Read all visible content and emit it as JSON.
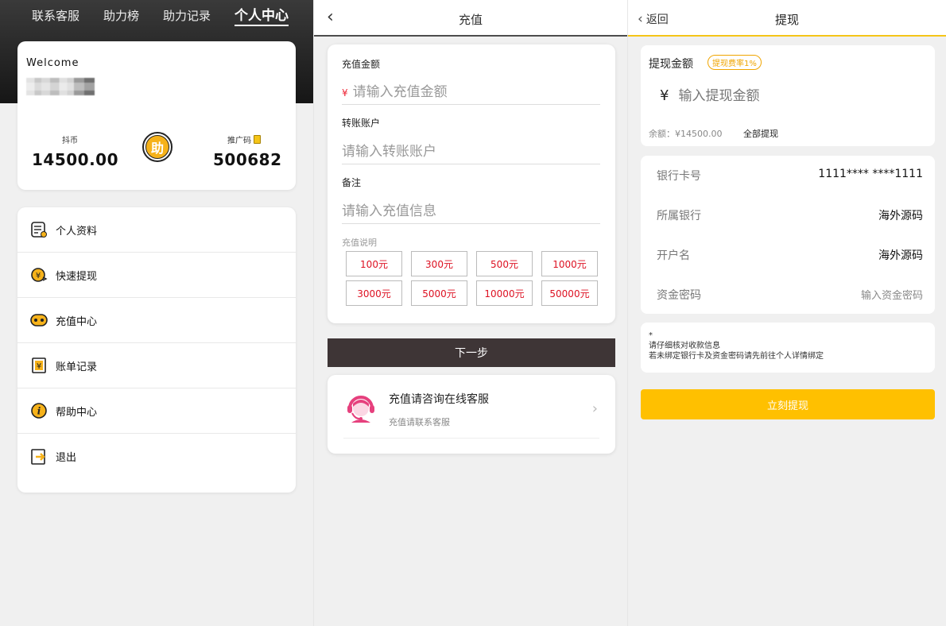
{
  "profile_panel": {
    "nav": [
      "联系客服",
      "助力榜",
      "助力记录",
      "个人中心"
    ],
    "welcome": "Welcome",
    "coins_label": "抖币",
    "coins_value": "14500.00",
    "badge_glyph": "助",
    "promo_label": "推广码",
    "promo_value": "500682",
    "menu": [
      {
        "label": "个人资料",
        "icon": "profile-icon"
      },
      {
        "label": "快速提现",
        "icon": "withdraw-icon"
      },
      {
        "label": "充值中心",
        "icon": "recharge-icon"
      },
      {
        "label": "账单记录",
        "icon": "bill-icon"
      },
      {
        "label": "帮助中心",
        "icon": "help-icon"
      },
      {
        "label": "退出",
        "icon": "logout-icon"
      }
    ],
    "colors": {
      "accent": "#f6b21a",
      "header_dark": "#1c1c1c"
    }
  },
  "recharge_panel": {
    "title": "充值",
    "amount_label": "充值金额",
    "amount_symbol": "¥",
    "amount_placeholder": "请输入充值金额",
    "account_label": "转账账户",
    "account_placeholder": "请输入转账账户",
    "note_label": "备注",
    "note_placeholder": "请输入充值信息",
    "amounts_label": "充值说明",
    "amounts": [
      "100元",
      "300元",
      "500元",
      "1000元",
      "3000元",
      "5000元",
      "10000元",
      "50000元"
    ],
    "next_label": "下一步",
    "service_title": "充值请咨询在线客服",
    "service_sub": "充值请联系客服",
    "colors": {
      "next_button": "#3e3536",
      "amount_text": "#d12222"
    }
  },
  "withdraw_panel": {
    "back_label": "返回",
    "title": "提现",
    "amount_label": "提现金额",
    "fee_badge": "提现费率1%",
    "amount_symbol": "¥",
    "amount_placeholder": "输入提现金额",
    "balance": "余额：¥14500.00",
    "withdraw_all": "全部提现",
    "fields": [
      {
        "key": "银行卡号",
        "value": "1111**** ****1111"
      },
      {
        "key": "所属银行",
        "value": "海外源码"
      },
      {
        "key": "开户名",
        "value": "海外源码"
      },
      {
        "key": "资金密码",
        "value": "输入资金密码"
      }
    ],
    "notice_star": "*",
    "notice_1": "请仔细核对收款信息",
    "notice_2": "若未绑定银行卡及资金密码请先前往个人详情绑定",
    "submit_label": "立刻提现",
    "colors": {
      "submit": "#ffc000",
      "underline": "#f5c518",
      "badge": "#f0a500"
    }
  }
}
